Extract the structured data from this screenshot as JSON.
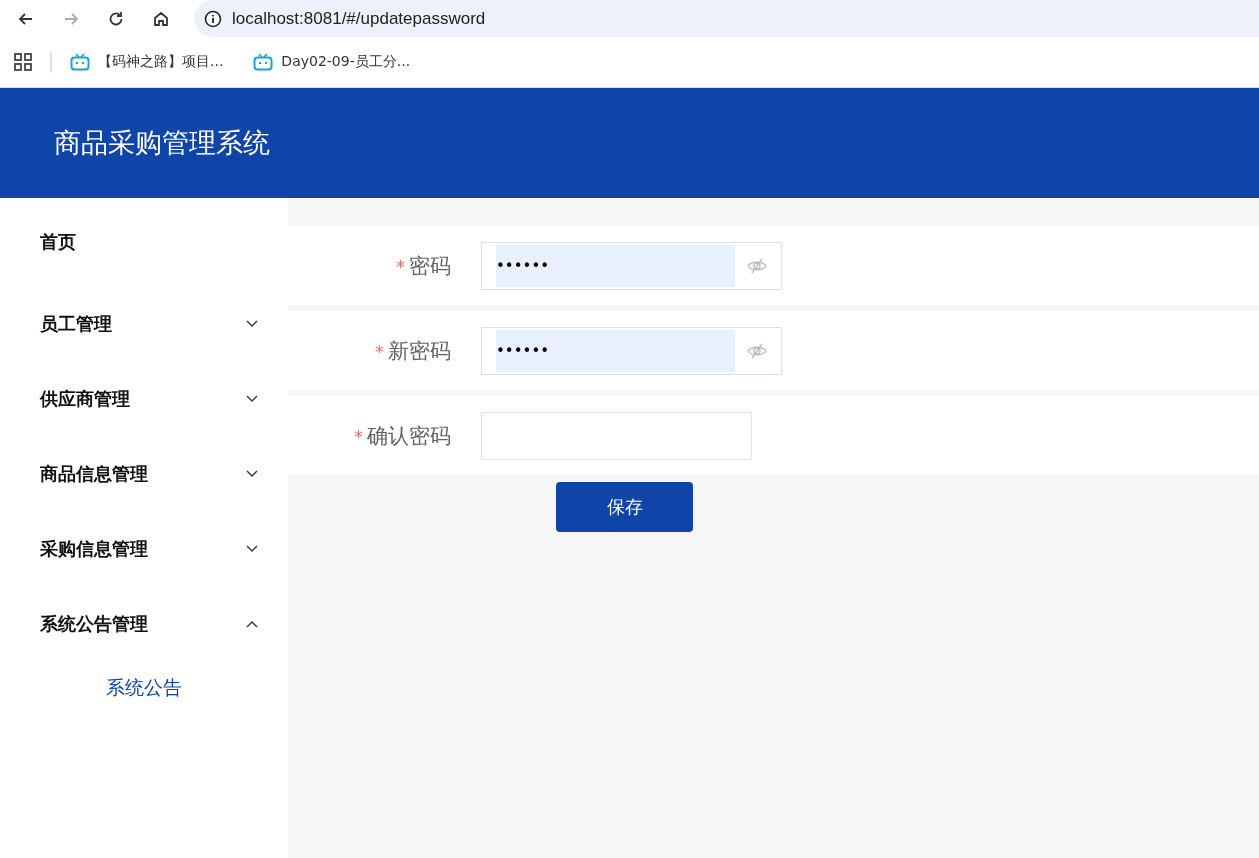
{
  "browser": {
    "url": "localhost:8081/#/updatepassword",
    "bookmarks": [
      {
        "label": "【码神之路】项目..."
      },
      {
        "label": "Day02-09-员工分..."
      }
    ]
  },
  "header": {
    "title": "商品采购管理系统"
  },
  "sidebar": {
    "items": [
      {
        "kind": "link",
        "label": "首页"
      },
      {
        "kind": "submenu",
        "label": "员工管理",
        "expanded": false
      },
      {
        "kind": "submenu",
        "label": "供应商管理",
        "expanded": false
      },
      {
        "kind": "submenu",
        "label": "商品信息管理",
        "expanded": false
      },
      {
        "kind": "submenu",
        "label": "采购信息管理",
        "expanded": false
      },
      {
        "kind": "submenu",
        "label": "系统公告管理",
        "expanded": true,
        "children": [
          {
            "label": "系统公告",
            "selected": true
          }
        ]
      }
    ]
  },
  "form": {
    "fields": [
      {
        "required_mark": "*",
        "label": "密码",
        "value": "••••••",
        "autofilled": true,
        "password_toggle": true
      },
      {
        "required_mark": "*",
        "label": "新密码",
        "value": "••••••",
        "autofilled": true,
        "password_toggle": true
      },
      {
        "required_mark": "*",
        "label": "确认密码",
        "autofilled": false,
        "password_toggle": false
      }
    ],
    "submit": "保存"
  }
}
